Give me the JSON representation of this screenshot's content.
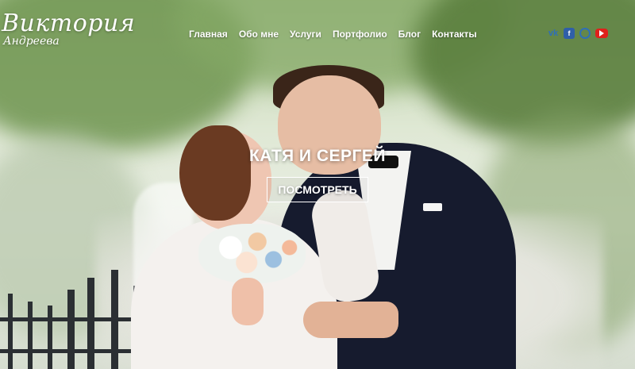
{
  "brand": {
    "name": "Виктория",
    "surname": "Андреева"
  },
  "nav": {
    "items": [
      {
        "label": "Главная"
      },
      {
        "label": "Обо мне"
      },
      {
        "label": "Услуги"
      },
      {
        "label": "Портфолио"
      },
      {
        "label": "Блог"
      },
      {
        "label": "Контакты"
      }
    ]
  },
  "social": {
    "vk": {
      "icon": "vk-icon"
    },
    "facebook": {
      "icon": "facebook-icon"
    },
    "instagram": {
      "icon": "instagram-icon"
    },
    "youtube": {
      "icon": "youtube-icon"
    }
  },
  "hero": {
    "title": "КАТЯ И СЕРГЕЙ",
    "button_label": "ПОСМОТРЕТЬ"
  }
}
